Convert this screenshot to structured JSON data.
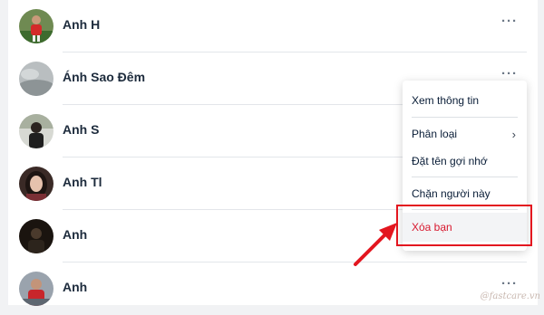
{
  "contacts": [
    {
      "name": "Anh H"
    },
    {
      "name": "Ánh Sao Đêm"
    },
    {
      "name": "Anh S"
    },
    {
      "name": "Anh Tl"
    },
    {
      "name": "Anh"
    },
    {
      "name": "Anh"
    }
  ],
  "more_icon": "more-horizontal-icon",
  "context_menu": {
    "view_info": "Xem thông tin",
    "classify": "Phân loại",
    "set_nickname": "Đặt tên gợi nhớ",
    "block_user": "Chặn người này",
    "remove_friend": "Xóa bạn"
  },
  "annotation": {
    "highlight_color": "#e3161f",
    "arrow_color": "#e3161f"
  },
  "watermark": "@fastcare.vn"
}
